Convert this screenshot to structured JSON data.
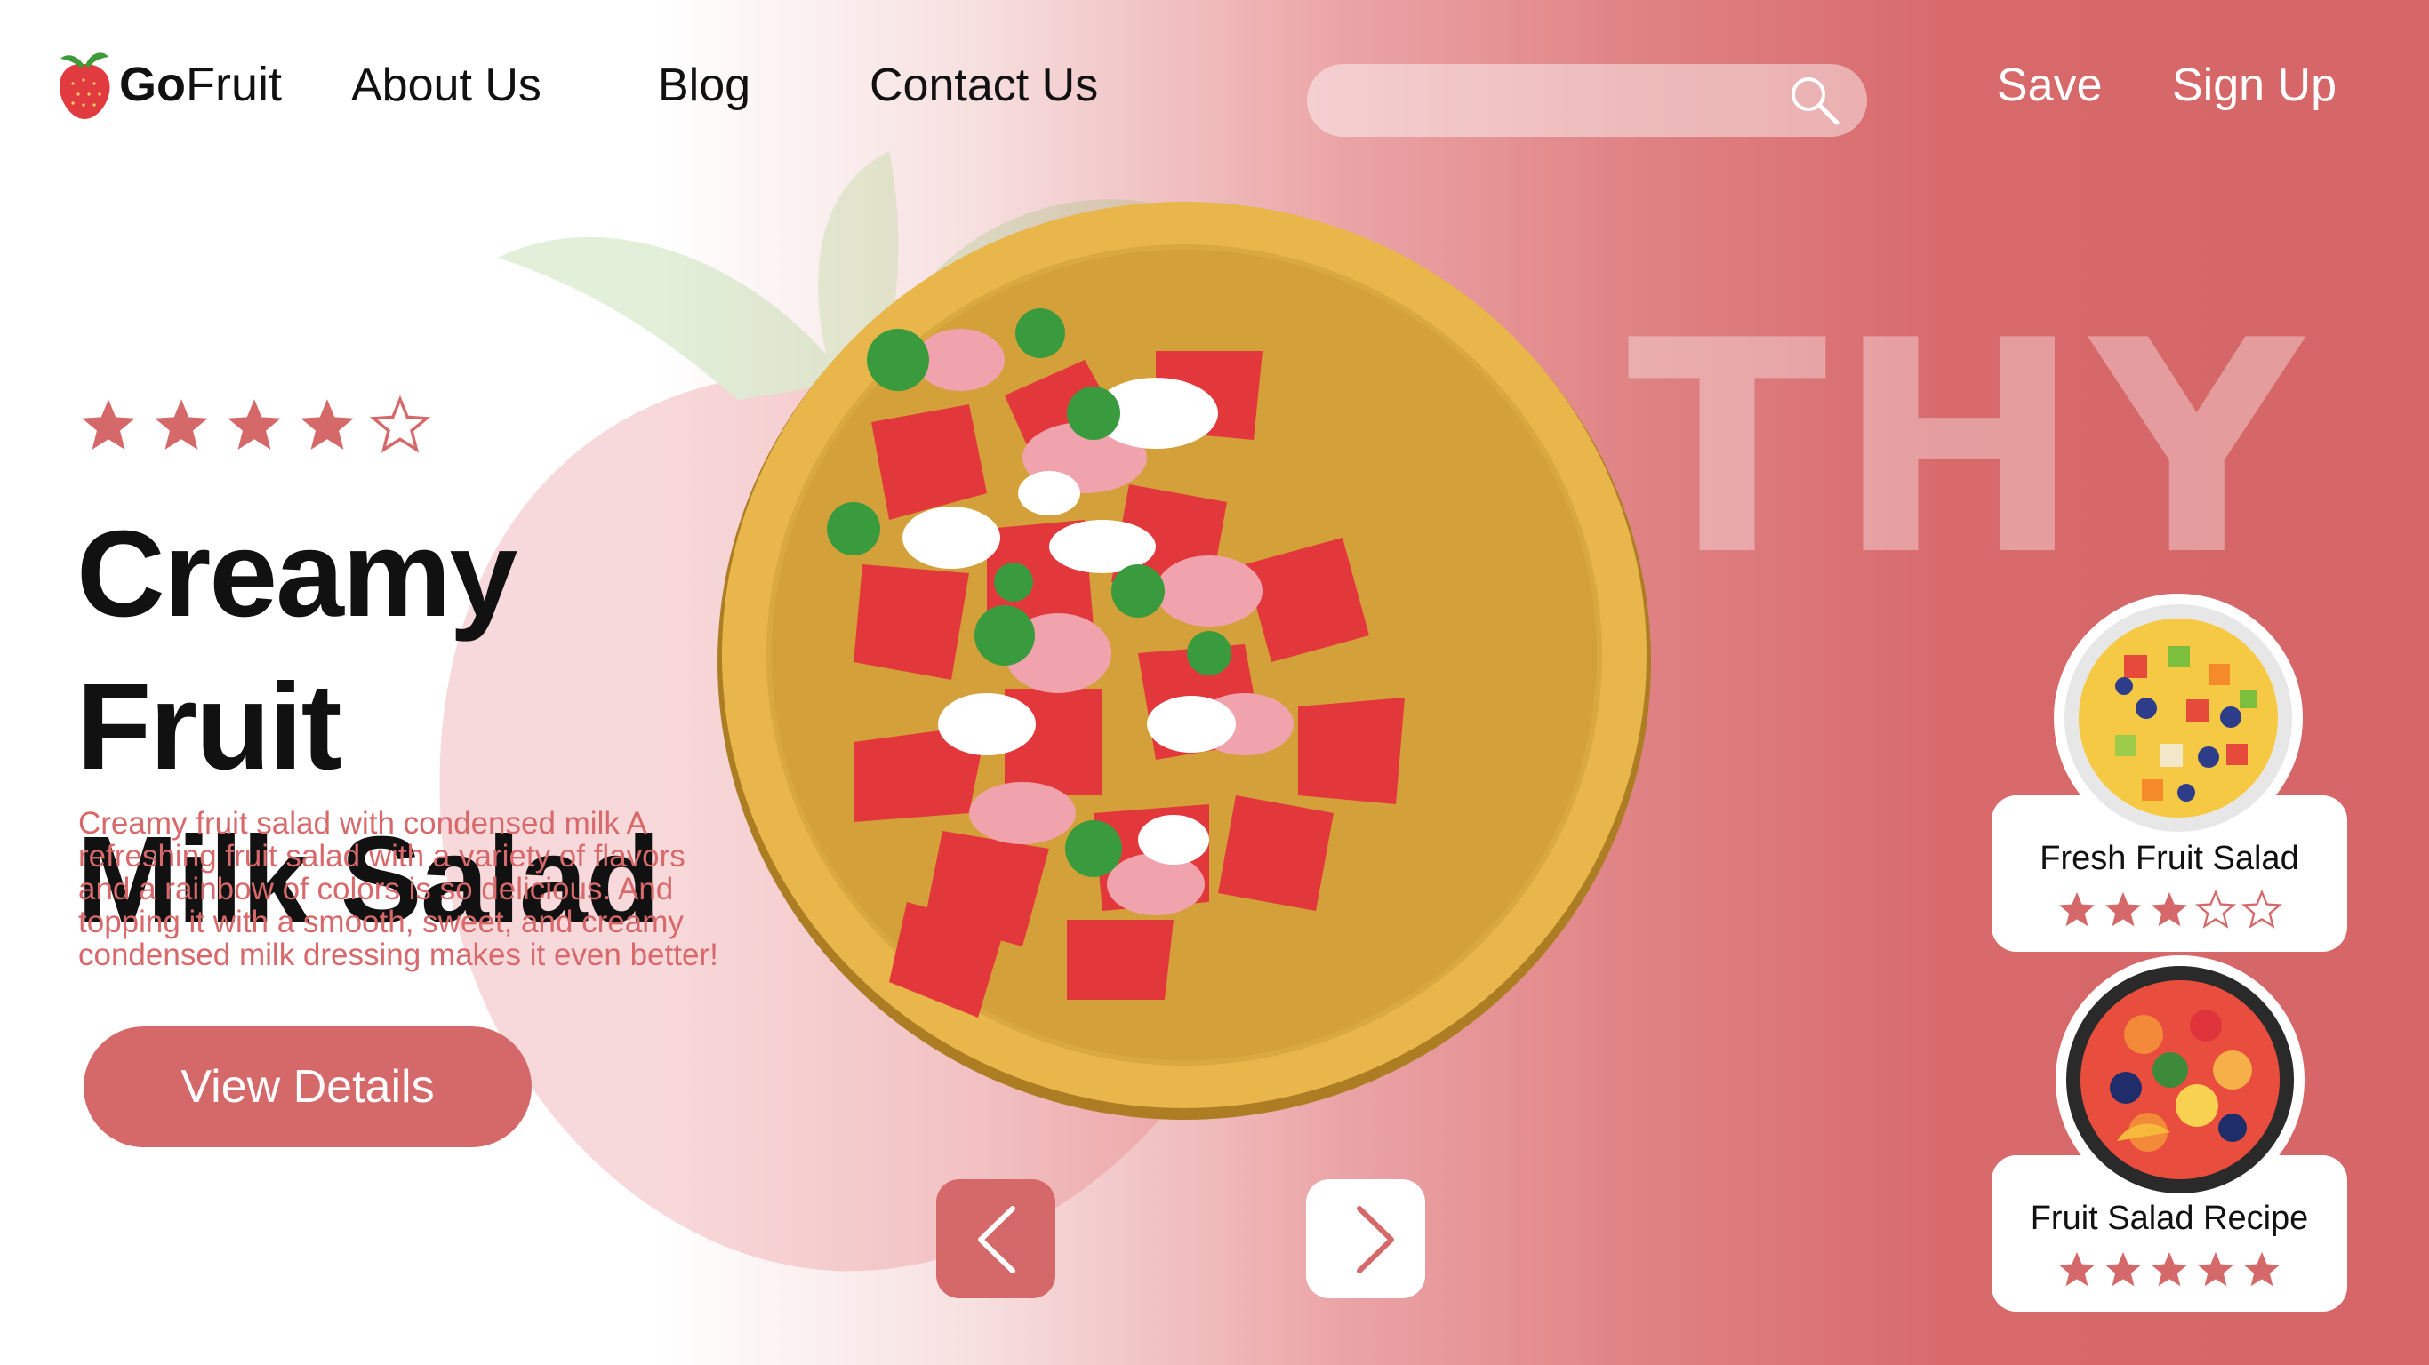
{
  "brand": {
    "bold": "Go",
    "regular": "Fruit"
  },
  "nav": {
    "about": "About Us",
    "blog": "Blog",
    "contact": "Contact Us",
    "save": "Save",
    "signup": "Sign Up"
  },
  "search": {
    "placeholder": "",
    "value": ""
  },
  "watermark": "THY",
  "hero": {
    "rating": 4,
    "rating_max": 5,
    "title_line1": "Creamy Fruit",
    "title_line2": "Milk Salad",
    "description": "Creamy fruit salad with condensed milk A refreshing fruit salad with a variety of flavors and a rainbow of colors is so delicious. And topping it with a smooth, sweet, and creamy condensed milk dressing makes it even better!",
    "cta": "View Details"
  },
  "cards": [
    {
      "title": "Fresh Fruit Salad",
      "rating": 3,
      "rating_max": 5
    },
    {
      "title": "Fruit Salad Recipe",
      "rating": 5,
      "rating_max": 5
    }
  ],
  "colors": {
    "accent": "#d56868",
    "text_dark": "#111111",
    "white": "#ffffff",
    "plate": "#d9a83f"
  },
  "icons": {
    "logo": "strawberry-icon",
    "search": "search-icon",
    "prev": "chevron-left-icon",
    "next": "chevron-right-icon",
    "star": "star-icon"
  }
}
